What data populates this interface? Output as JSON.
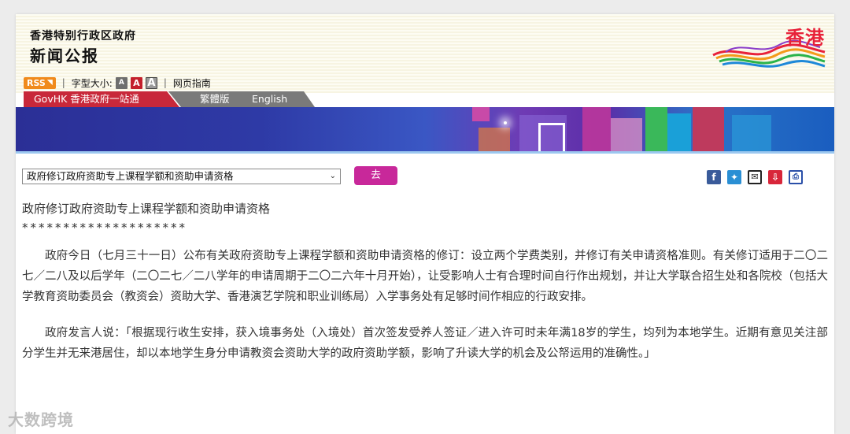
{
  "header": {
    "gov_name": "香港特别行政区政府",
    "news_title": "新闻公报",
    "logo_text": "香港"
  },
  "toolbar": {
    "rss_label": "RSS",
    "font_size_label": "字型大小:",
    "font_small": "A",
    "font_medium": "A",
    "font_large": "A",
    "sitemap_label": "网页指南"
  },
  "nav": {
    "govhk_label": "GovHK 香港政府一站通",
    "traditional_label": "繁體版",
    "english_label": "English"
  },
  "controls": {
    "select_value": "政府修订政府资助专上课程学额和资助申请资格",
    "go_label": "去"
  },
  "article": {
    "title": "政府修订政府资助专上课程学额和资助申请资格",
    "stars": "********************",
    "paragraphs": [
      "政府今日（七月三十一日）公布有关政府资助专上课程学额和资助申请资格的修订：设立两个学费类别，并修订有关申请资格准则。有关修订适用于二〇二七／二八及以后学年（二〇二七／二八学年的申请周期于二〇二六年十月开始），让受影响人士有合理时间自行作出规划，并让大学联合招生处和各院校（包括大学教育资助委员会（教资会）资助大学、香港演艺学院和职业训练局）入学事务处有足够时间作相应的行政安排。",
      "政府发言人说：「根据现行收生安排，获入境事务处（入境处）首次签发受养人签证／进入许可时未年满18岁的学生，均列为本地学生。近期有意见关注部分学生并无来港居住，却以本地学生身分申请教资会资助大学的政府资助学额，影响了升读大学的机会及公帑运用的准确性。」"
    ]
  },
  "watermark": "大数跨境",
  "colors": {
    "govhk_red": "#c8283a",
    "go_button": "#c8289a",
    "rss_orange": "#f08a1c"
  }
}
